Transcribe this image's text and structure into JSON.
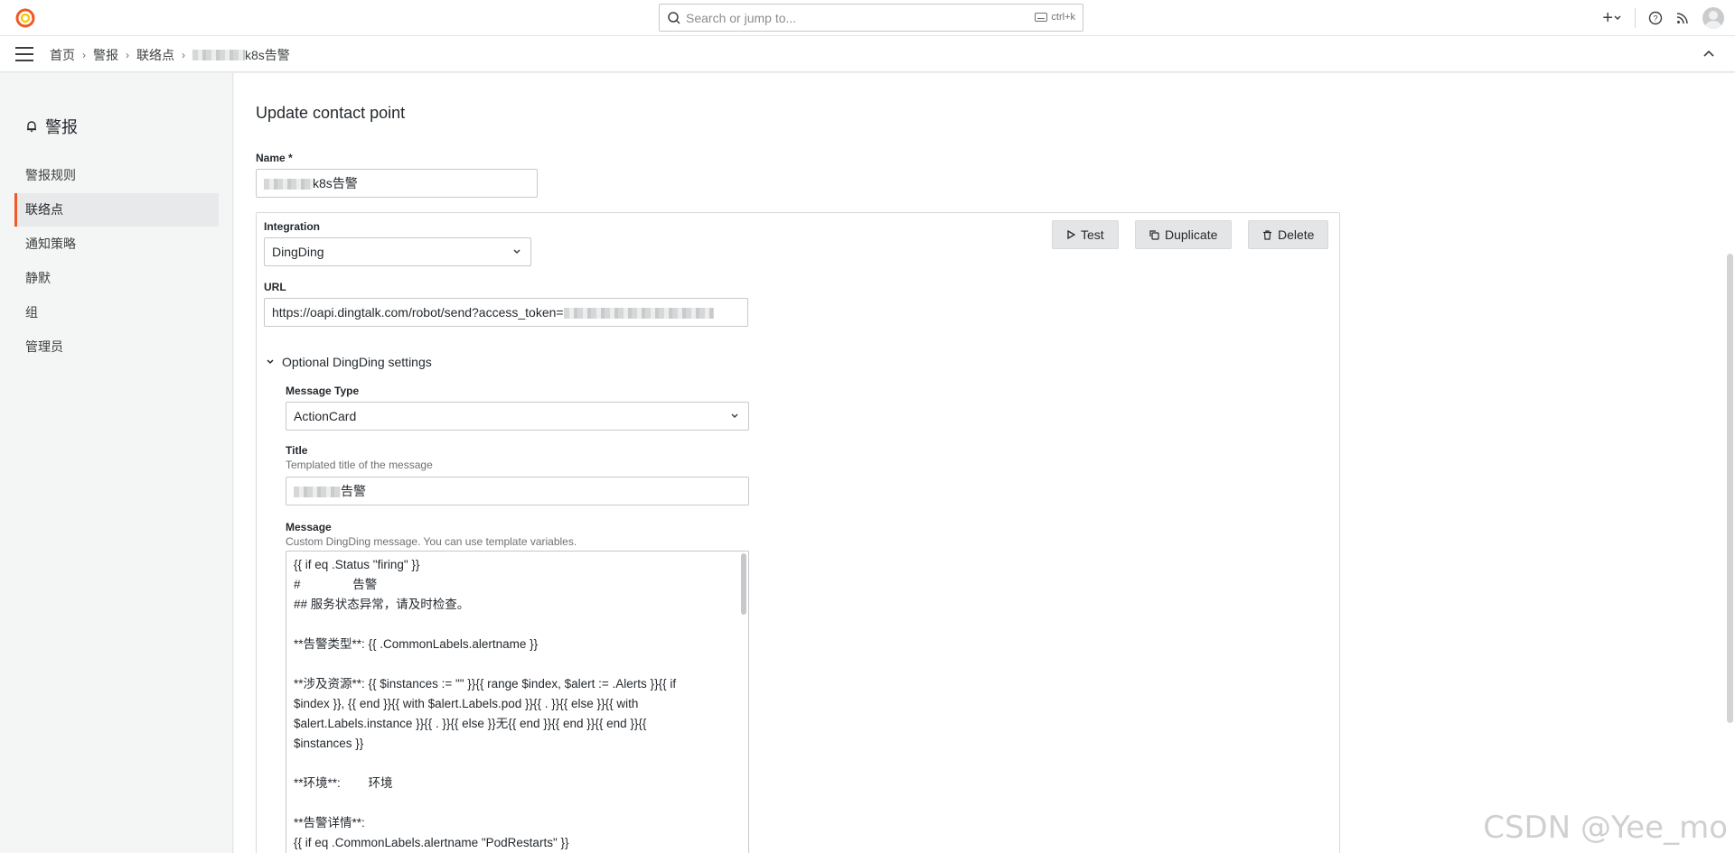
{
  "search": {
    "placeholder": "Search or jump to...",
    "shortcut": "ctrl+k"
  },
  "topbar": {
    "new_label": "+",
    "help": "?",
    "news": "rss"
  },
  "breadcrumb": {
    "items": [
      "首页",
      "警报",
      "联络点"
    ],
    "current_suffix": "k8s告警"
  },
  "sidebar": {
    "title": "警报",
    "items": [
      {
        "label": "警报规则",
        "active": false
      },
      {
        "label": "联络点",
        "active": true
      },
      {
        "label": "通知策略",
        "active": false
      },
      {
        "label": "静默",
        "active": false
      },
      {
        "label": "组",
        "active": false
      },
      {
        "label": "管理员",
        "active": false
      }
    ]
  },
  "form": {
    "page_title": "Update contact point",
    "name_label": "Name *",
    "name_value_suffix": "k8s告警",
    "integration_label": "Integration",
    "integration_value": "DingDing",
    "url_label": "URL",
    "url_value": "https://oapi.dingtalk.com/robot/send?access_token=",
    "buttons": {
      "test": "Test",
      "duplicate": "Duplicate",
      "delete": "Delete"
    },
    "optional_label": "Optional DingDing settings",
    "message_type_label": "Message Type",
    "message_type_value": "ActionCard",
    "title_label": "Title",
    "title_desc": "Templated title of the message",
    "title_value_suffix": "告警",
    "message_label": "Message",
    "message_desc": "Custom DingDing message. You can use template variables.",
    "message_lines": [
      "{{ if eq .Status \"firing\" }}",
      "#     告警",
      "## 服务状态异常，请及时检查。",
      "",
      "**告警类型**: {{ .CommonLabels.alertname }}",
      "",
      "**涉及资源**: {{ $instances := \"\" }}{{ range $index, $alert := .Alerts }}{{ if",
      "$index }}, {{ end }}{{ with $alert.Labels.pod }}{{ . }}{{ else }}{{ with",
      "$alert.Labels.instance }}{{ . }}{{ else }}无{{ end }}{{ end }}{{ end }}{{",
      "$instances }}",
      "",
      "**环境**:   环境",
      "",
      "**告警详情**:",
      "{{ if eq .CommonLabels.alertname \"PodRestarts\" }}"
    ]
  },
  "watermark": "CSDN @Yee_mo"
}
